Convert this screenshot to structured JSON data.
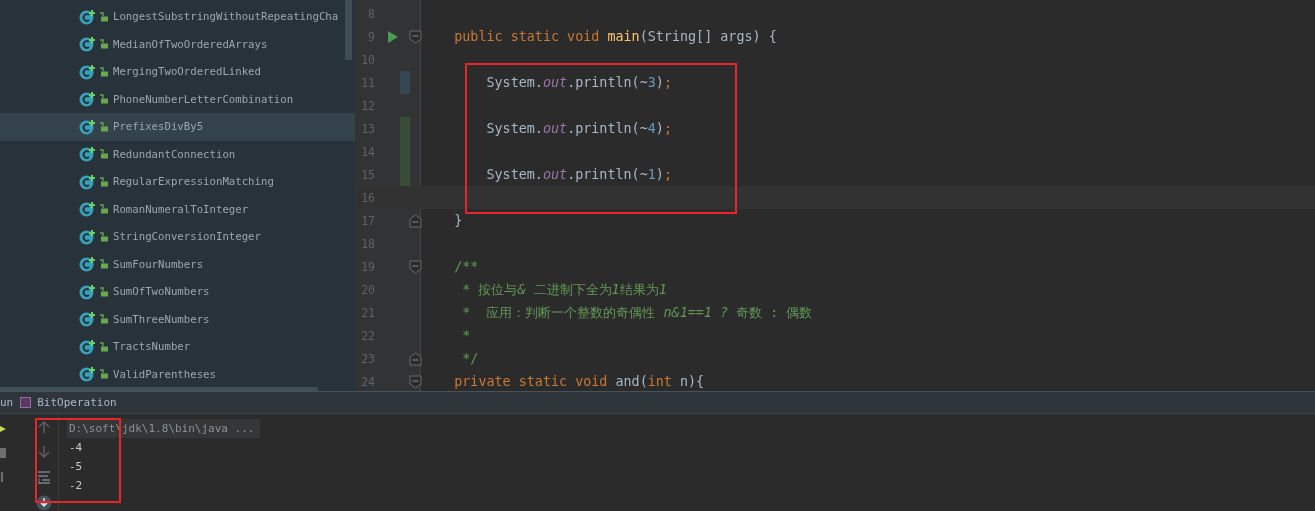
{
  "project_tree": {
    "items": [
      {
        "name": "LongestSubstringWithoutRepeatingCha",
        "selected": false
      },
      {
        "name": "MedianOfTwoOrderedArrays",
        "selected": false
      },
      {
        "name": "MergingTwoOrderedLinked",
        "selected": false
      },
      {
        "name": "PhoneNumberLetterCombination",
        "selected": false
      },
      {
        "name": "PrefixesDivBy5",
        "selected": true
      },
      {
        "name": "RedundantConnection",
        "selected": false
      },
      {
        "name": "RegularExpressionMatching",
        "selected": false
      },
      {
        "name": "RomanNumeralToInteger",
        "selected": false
      },
      {
        "name": "StringConversionInteger",
        "selected": false
      },
      {
        "name": "SumFourNumbers",
        "selected": false
      },
      {
        "name": "SumOfTwoNumbers",
        "selected": false
      },
      {
        "name": "SumThreeNumbers",
        "selected": false
      },
      {
        "name": "TractsNumber",
        "selected": false
      },
      {
        "name": "ValidParentheses",
        "selected": false
      }
    ]
  },
  "editor": {
    "lines": [
      {
        "number": "8"
      },
      {
        "number": "9",
        "run": true,
        "fold_open": true,
        "tokens": [
          {
            "text": "    public static void ",
            "kind": "keyword"
          },
          {
            "text": "main",
            "kind": "method"
          },
          {
            "text": "(String[] args) {",
            "kind": "plain"
          }
        ]
      },
      {
        "number": "10"
      },
      {
        "number": "11",
        "modified": true,
        "tokens": [
          {
            "text": "        System.",
            "kind": "plain"
          },
          {
            "text": "out",
            "kind": "field"
          },
          {
            "text": ".println(~",
            "kind": "plain"
          },
          {
            "text": "3",
            "kind": "number"
          },
          {
            "text": ")",
            "kind": "plain"
          },
          {
            "text": ";",
            "kind": "keyword"
          }
        ]
      },
      {
        "number": "12"
      },
      {
        "number": "13",
        "added": true,
        "tokens": [
          {
            "text": "        System.",
            "kind": "plain"
          },
          {
            "text": "out",
            "kind": "field"
          },
          {
            "text": ".println(~",
            "kind": "plain"
          },
          {
            "text": "4",
            "kind": "number"
          },
          {
            "text": ")",
            "kind": "plain"
          },
          {
            "text": ";",
            "kind": "keyword"
          }
        ]
      },
      {
        "number": "14",
        "added": true
      },
      {
        "number": "15",
        "added": true,
        "tokens": [
          {
            "text": "        System.",
            "kind": "plain"
          },
          {
            "text": "out",
            "kind": "field"
          },
          {
            "text": ".println(~",
            "kind": "plain"
          },
          {
            "text": "1",
            "kind": "number"
          },
          {
            "text": ")",
            "kind": "plain"
          },
          {
            "text": ";",
            "kind": "keyword"
          }
        ]
      },
      {
        "number": "16",
        "current": true
      },
      {
        "number": "17",
        "fold_close": true,
        "tokens": [
          {
            "text": "    }",
            "kind": "plain"
          }
        ]
      },
      {
        "number": "18"
      },
      {
        "number": "19",
        "fold_open": true,
        "tokens": [
          {
            "text": "    /**",
            "kind": "doc"
          }
        ]
      },
      {
        "number": "20",
        "tokens": [
          {
            "text": "     * 按位与",
            "kind": "doc"
          },
          {
            "text": "&",
            "kind": "doc_italic"
          },
          {
            "text": " 二进制下全为",
            "kind": "doc"
          },
          {
            "text": "1",
            "kind": "doc_italic"
          },
          {
            "text": "结果为",
            "kind": "doc"
          },
          {
            "text": "1",
            "kind": "doc_italic"
          }
        ]
      },
      {
        "number": "21",
        "tokens": [
          {
            "text": "     *  应用：判断一个整数的奇偶性 ",
            "kind": "doc"
          },
          {
            "text": "n&1==1 ?",
            "kind": "doc_italic"
          },
          {
            "text": " 奇数 : 偶数",
            "kind": "doc"
          }
        ]
      },
      {
        "number": "22",
        "tokens": [
          {
            "text": "     *",
            "kind": "doc"
          }
        ]
      },
      {
        "number": "23",
        "fold_close": true,
        "tokens": [
          {
            "text": "     */",
            "kind": "doc"
          }
        ]
      },
      {
        "number": "24",
        "fold_open": true,
        "tokens": [
          {
            "text": "    private static void ",
            "kind": "keyword"
          },
          {
            "text": "and(",
            "kind": "plain"
          },
          {
            "text": "int ",
            "kind": "keyword"
          },
          {
            "text": "n){",
            "kind": "plain"
          }
        ]
      }
    ]
  },
  "run_panel": {
    "header_label": "un",
    "tab": "BitOperation",
    "console": [
      {
        "text": "D:\\soft\\jdk\\1.8\\bin\\java ...",
        "kind": "command"
      },
      {
        "text": "-4",
        "kind": "output"
      },
      {
        "text": "-5",
        "kind": "output"
      },
      {
        "text": "-2",
        "kind": "output"
      }
    ]
  }
}
